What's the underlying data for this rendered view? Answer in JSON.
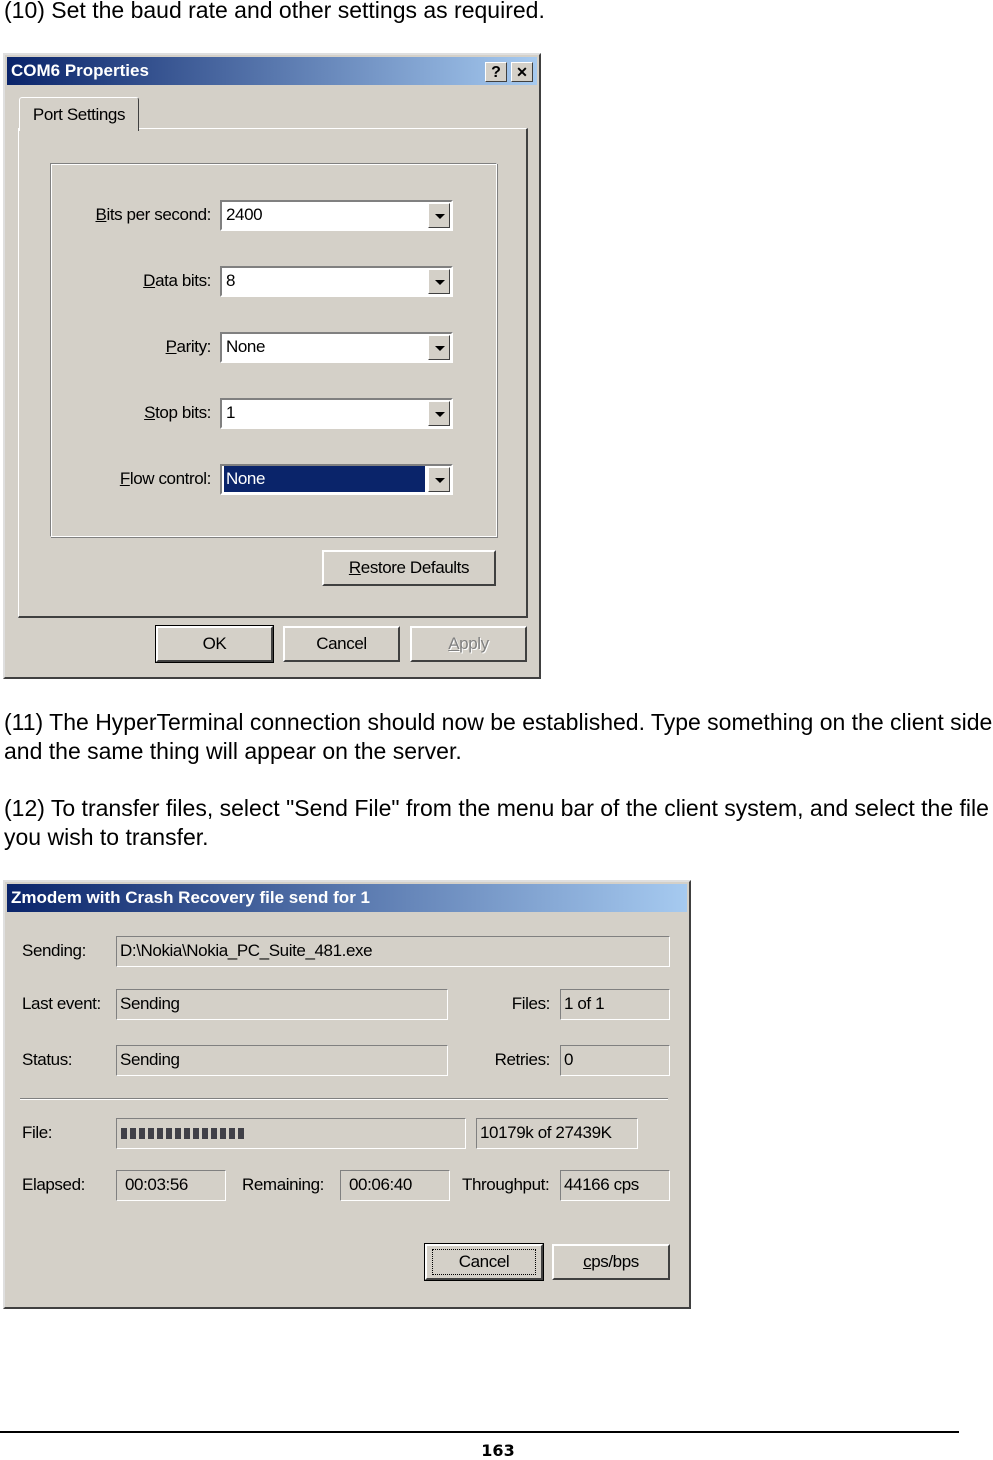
{
  "doc": {
    "step10": "(10) Set the baud rate and other settings as required.",
    "step11": "(11) The HyperTerminal connection should now be established. Type something on the client side and the same thing will appear on the server.",
    "step12": "(12) To transfer files, select \"Send File\" from the menu bar of the client system, and select the file you wish to transfer.",
    "page_number": "163"
  },
  "com_dialog": {
    "title": "COM6 Properties",
    "help": "?",
    "close": "✕",
    "tab": "Port Settings",
    "fields": [
      {
        "label": "Bits per second:",
        "value": "2400"
      },
      {
        "label": "Data bits:",
        "value": "8"
      },
      {
        "label": "Parity:",
        "value": "None"
      },
      {
        "label": "Stop bits:",
        "value": "1"
      },
      {
        "label": "Flow control:",
        "value": "None",
        "selected": true
      }
    ],
    "restore": "Restore Defaults",
    "ok": "OK",
    "cancel": "Cancel",
    "apply": "Apply"
  },
  "zmodem": {
    "title": "Zmodem with Crash Recovery file send for 1",
    "sending_label": "Sending:",
    "sending": "D:\\Nokia\\Nokia_PC_Suite_481.exe",
    "last_event_label": "Last event:",
    "last_event": "Sending",
    "files_label": "Files:",
    "files": "1 of 1",
    "status_label": "Status:",
    "status": "Sending",
    "retries_label": "Retries:",
    "retries": "0",
    "file_label": "File:",
    "progress_percent": 37,
    "file_count": "10179k of 27439K",
    "elapsed_label": "Elapsed:",
    "elapsed": "00:03:56",
    "remaining_label": "Remaining:",
    "remaining": "00:06:40",
    "throughput_label": "Throughput:",
    "throughput": "44166 cps",
    "cancel": "Cancel",
    "cpsbps": "cps/bps"
  },
  "colors": {
    "titlebar_start": "#0a246a",
    "titlebar_end": "#a6caf0",
    "face": "#d4d0c8",
    "selection": "#0a246a"
  }
}
